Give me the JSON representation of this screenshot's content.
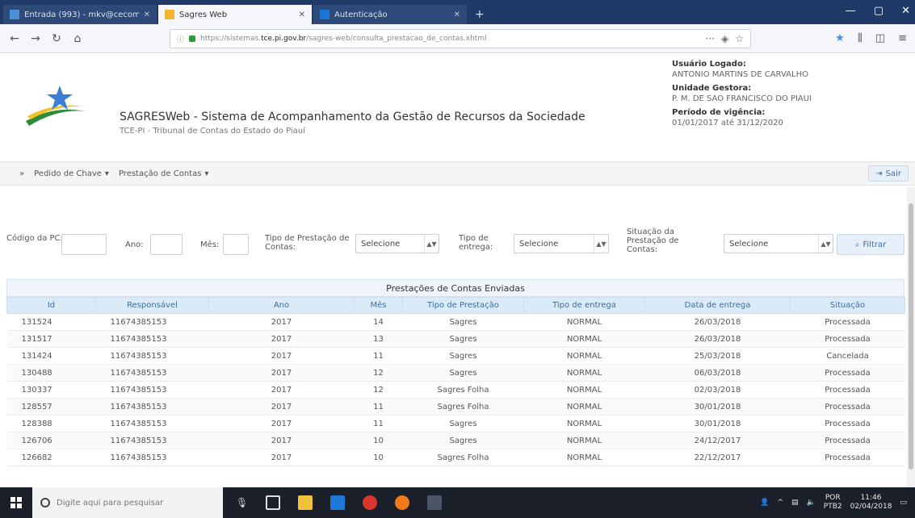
{
  "browser": {
    "tabs": [
      {
        "title": "Entrada (993) - mkv@cecom - ...",
        "active": false
      },
      {
        "title": "Sagres Web",
        "active": true
      },
      {
        "title": "Autenticação",
        "active": false
      }
    ],
    "url_prefix": "https://sistemas.",
    "url_host": "tce.pi.gov.br",
    "url_path": "/sagres-web/consulta_prestacao_de_contas.xhtml"
  },
  "header": {
    "title": "SAGRESWeb - Sistema de Acompanhamento da Gestão de Recursos da Sociedade",
    "subtitle": "TCE-PI - Tribunal de Contas do Estado do Piauí",
    "user_label": "Usuário Logado:",
    "user_value": "ANTONIO MARTINS DE CARVALHO",
    "unit_label": "Unidade Gestora:",
    "unit_value": "P. M. DE SAO FRANCISCO DO PIAUI",
    "period_label": "Período de vigência:",
    "period_value": "01/01/2017 até 31/12/2020"
  },
  "menu": {
    "items": [
      "Pedido de Chave",
      "Prestação de Contas"
    ],
    "logout": "Sair"
  },
  "filters": {
    "codigo_label": "Código da PC:",
    "ano_label": "Ano:",
    "mes_label": "Mês:",
    "tipo_prestacao_label": "Tipo de Prestação de Contas:",
    "tipo_prestacao_value": "Selecione",
    "tipo_entrega_label": "Tipo de entrega:",
    "tipo_entrega_value": "Selecione",
    "situacao_label": "Situação da Prestação de Contas:",
    "situacao_value": "Selecione",
    "filter_button": "Filtrar"
  },
  "table": {
    "caption": "Prestações de Contas Enviadas",
    "columns": [
      "Id",
      "Responsável",
      "Ano",
      "Mês",
      "Tipo de Prestação",
      "Tipo de entrega",
      "Data de entrega",
      "Situação"
    ],
    "rows": [
      [
        "131524",
        "11674385153",
        "2017",
        "14",
        "Sagres",
        "NORMAL",
        "26/03/2018",
        "Processada"
      ],
      [
        "131517",
        "11674385153",
        "2017",
        "13",
        "Sagres",
        "NORMAL",
        "26/03/2018",
        "Processada"
      ],
      [
        "131424",
        "11674385153",
        "2017",
        "11",
        "Sagres",
        "NORMAL",
        "25/03/2018",
        "Cancelada"
      ],
      [
        "130488",
        "11674385153",
        "2017",
        "12",
        "Sagres",
        "NORMAL",
        "06/03/2018",
        "Processada"
      ],
      [
        "130337",
        "11674385153",
        "2017",
        "12",
        "Sagres Folha",
        "NORMAL",
        "02/03/2018",
        "Processada"
      ],
      [
        "128557",
        "11674385153",
        "2017",
        "11",
        "Sagres Folha",
        "NORMAL",
        "30/01/2018",
        "Processada"
      ],
      [
        "128388",
        "11674385153",
        "2017",
        "11",
        "Sagres",
        "NORMAL",
        "30/01/2018",
        "Processada"
      ],
      [
        "126706",
        "11674385153",
        "2017",
        "10",
        "Sagres",
        "NORMAL",
        "24/12/2017",
        "Processada"
      ],
      [
        "126682",
        "11674385153",
        "2017",
        "10",
        "Sagres Folha",
        "NORMAL",
        "22/12/2017",
        "Processada"
      ]
    ]
  },
  "taskbar": {
    "search_placeholder": "Digite aqui para pesquisar",
    "lang": "POR",
    "lang2": "PTB2",
    "time": "11:46",
    "date": "02/04/2018"
  },
  "colors": {
    "accent": "#3e6e9e",
    "header_bg": "#dbeaf7",
    "taskbar": "#1b1f2a"
  }
}
